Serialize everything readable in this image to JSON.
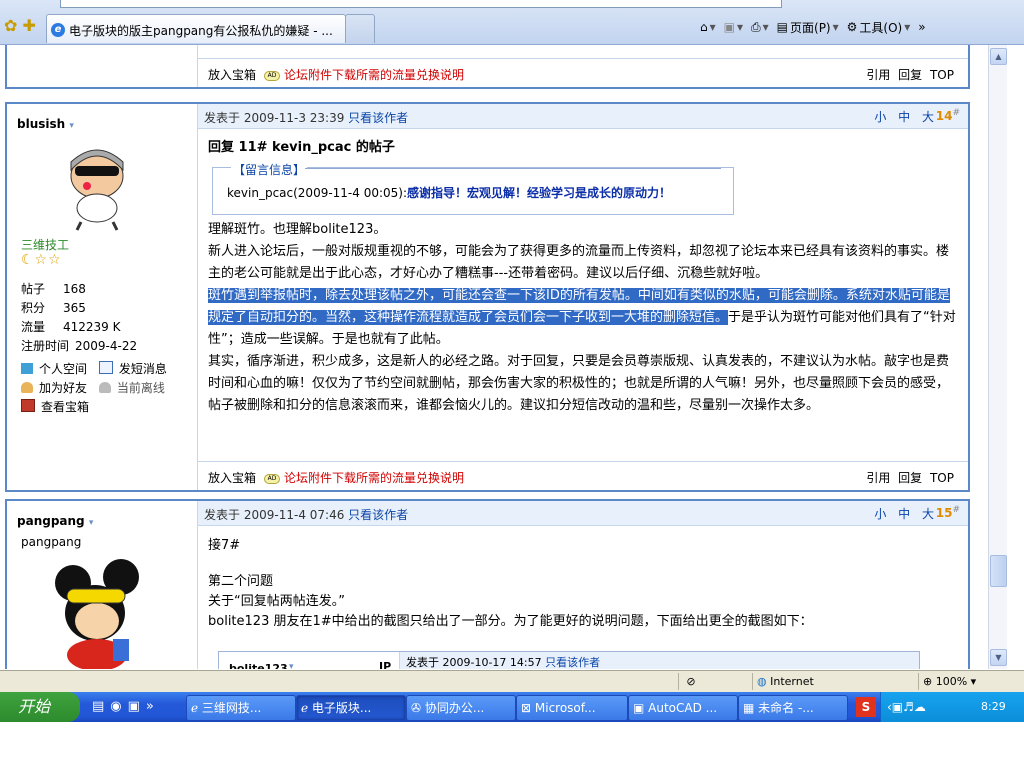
{
  "browser": {
    "tab_title": "电子版块的版主pangpang有公报私仇的嫌疑 - ...",
    "commands": {
      "page": "页面(P)",
      "tools": "工具(O)"
    }
  },
  "prev_footer": {
    "treasure": "放入宝箱",
    "ad_link": "论坛附件下载所需的流量兑换说明",
    "actions": "引用 回复 TOP"
  },
  "post14": {
    "author": "blusish",
    "rank": "三维技工",
    "stars": "☾☆☆",
    "stats": [
      {
        "label": "帖子",
        "value": "168"
      },
      {
        "label": "积分",
        "value": "365"
      },
      {
        "label": "流量",
        "value": "412239 K"
      },
      {
        "label": "注册时间",
        "value": "2009-4-22"
      }
    ],
    "links": {
      "space": "个人空间",
      "pm": "发短消息",
      "friend": "加为好友",
      "status": "当前离线",
      "treasure": "查看宝箱"
    },
    "meta_prefix": "发表于",
    "date": "2009-11-3 23:39",
    "only_author": "只看该作者",
    "sizes": "小 中 大",
    "floor": "14",
    "floor_mark": "#",
    "title": "回复  11# kevin_pcac 的帖子",
    "quote_title": "【留言信息】",
    "quote_author": "kevin_pcac(2009-11-4 00:05):",
    "quote_text": "感谢指导！宏观见解！经验学习是成长的原动力！",
    "p1": "理解斑竹。也理解bolite123。",
    "p2": "新人进入论坛后，一般对版规重视的不够，可能会为了获得更多的流量而上传资料，却忽视了论坛本来已经具有该资料的事实。楼主的老公可能就是出于此心态，才好心办了糟糕事---还带着密码。建议以后仔细、沉稳些就好啦。",
    "p3_highlight": "斑竹遇到举报帖时，除去处理该帖之外，可能还会查一下该ID的所有发帖。中间如有类似的水贴，可能会删除。系统对水贴可能是规定了自动扣分的。当然，这种操作流程就造成了会员们会一下子收到一大堆的删除短信。",
    "p3_rest": "于是乎认为斑竹可能对他们具有了“针对性”；造成一些误解。于是也就有了此帖。",
    "p4": "其实，循序渐进，积少成多，这是新人的必经之路。对于回复，只要是会员尊崇版规、认真发表的，不建议认为水帖。敲字也是费时间和心血的嘛！仅仅为了节约空间就删帖，那会伤害大家的积极性的；也就是所谓的人气嘛！另外，也尽量照顾下会员的感受，帖子被删除和扣分的信息滚滚而来，谁都会恼火儿的。建议扣分短信改动的温和些，尽量别一次操作太多。",
    "footer": {
      "treasure": "放入宝箱",
      "ad_link": "论坛附件下载所需的流量兑换说明",
      "actions": "引用 回复 TOP"
    }
  },
  "post15": {
    "author": "pangpang",
    "nick": "pangpang",
    "meta_prefix": "发表于",
    "date": "2009-11-4 07:46",
    "only_author": "只看该作者",
    "sizes": "小 中 大",
    "floor": "15",
    "floor_mark": "#",
    "l1": "接7#",
    "l2": "第二个问题",
    "l3": "关于“回复帖两帖连发。”",
    "l4": "bolite123 朋友在1#中给出的截图只给出了一部分。为了能更好的说明问题，下面给出更全的截图如下：",
    "nested_user": "bolite123",
    "nested_ip": "IP",
    "nested_prefix": "发表于",
    "nested_date": "2009-10-17 14:57",
    "nested_only": "只看该作者"
  },
  "status": {
    "zone": "Internet",
    "zoom": "100%"
  },
  "taskbar": {
    "start": "开始",
    "tasks": [
      "三维网技...",
      "电子版块...",
      "协同办公...",
      "Microsof...",
      "AutoCAD ...",
      "未命名 -..."
    ],
    "time": "8:29"
  }
}
